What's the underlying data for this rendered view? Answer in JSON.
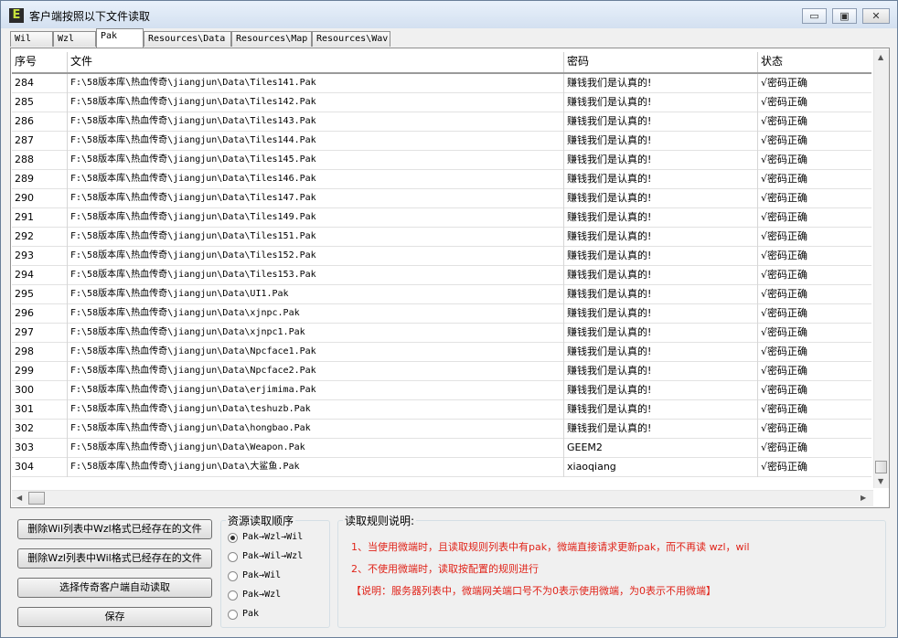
{
  "window": {
    "title": "客户端按照以下文件读取",
    "icon_letter": "E",
    "minimize": "▭",
    "maximize": "▣",
    "close": "✕"
  },
  "tabs": [
    "Wil",
    "Wzl",
    "Pak",
    "Resources\\Data",
    "Resources\\Map",
    "Resources\\Wav"
  ],
  "active_tab": "Pak",
  "table": {
    "headers": [
      "序号",
      "文件",
      "密码",
      "状态"
    ],
    "rows": [
      [
        "284",
        "F:\\58版本库\\热血传奇\\jiangjun\\Data\\Tiles141.Pak",
        "赚钱我们是认真的!",
        "√密码正确"
      ],
      [
        "285",
        "F:\\58版本库\\热血传奇\\jiangjun\\Data\\Tiles142.Pak",
        "赚钱我们是认真的!",
        "√密码正确"
      ],
      [
        "286",
        "F:\\58版本库\\热血传奇\\jiangjun\\Data\\Tiles143.Pak",
        "赚钱我们是认真的!",
        "√密码正确"
      ],
      [
        "287",
        "F:\\58版本库\\热血传奇\\jiangjun\\Data\\Tiles144.Pak",
        "赚钱我们是认真的!",
        "√密码正确"
      ],
      [
        "288",
        "F:\\58版本库\\热血传奇\\jiangjun\\Data\\Tiles145.Pak",
        "赚钱我们是认真的!",
        "√密码正确"
      ],
      [
        "289",
        "F:\\58版本库\\热血传奇\\jiangjun\\Data\\Tiles146.Pak",
        "赚钱我们是认真的!",
        "√密码正确"
      ],
      [
        "290",
        "F:\\58版本库\\热血传奇\\jiangjun\\Data\\Tiles147.Pak",
        "赚钱我们是认真的!",
        "√密码正确"
      ],
      [
        "291",
        "F:\\58版本库\\热血传奇\\jiangjun\\Data\\Tiles149.Pak",
        "赚钱我们是认真的!",
        "√密码正确"
      ],
      [
        "292",
        "F:\\58版本库\\热血传奇\\jiangjun\\Data\\Tiles151.Pak",
        "赚钱我们是认真的!",
        "√密码正确"
      ],
      [
        "293",
        "F:\\58版本库\\热血传奇\\jiangjun\\Data\\Tiles152.Pak",
        "赚钱我们是认真的!",
        "√密码正确"
      ],
      [
        "294",
        "F:\\58版本库\\热血传奇\\jiangjun\\Data\\Tiles153.Pak",
        "赚钱我们是认真的!",
        "√密码正确"
      ],
      [
        "295",
        "F:\\58版本库\\热血传奇\\jiangjun\\Data\\UI1.Pak",
        "赚钱我们是认真的!",
        "√密码正确"
      ],
      [
        "296",
        "F:\\58版本库\\热血传奇\\jiangjun\\Data\\xjnpc.Pak",
        "赚钱我们是认真的!",
        "√密码正确"
      ],
      [
        "297",
        "F:\\58版本库\\热血传奇\\jiangjun\\Data\\xjnpc1.Pak",
        "赚钱我们是认真的!",
        "√密码正确"
      ],
      [
        "298",
        "F:\\58版本库\\热血传奇\\jiangjun\\Data\\Npcface1.Pak",
        "赚钱我们是认真的!",
        "√密码正确"
      ],
      [
        "299",
        "F:\\58版本库\\热血传奇\\jiangjun\\Data\\Npcface2.Pak",
        "赚钱我们是认真的!",
        "√密码正确"
      ],
      [
        "300",
        "F:\\58版本库\\热血传奇\\jiangjun\\Data\\erjimima.Pak",
        "赚钱我们是认真的!",
        "√密码正确"
      ],
      [
        "301",
        "F:\\58版本库\\热血传奇\\jiangjun\\Data\\teshuzb.Pak",
        "赚钱我们是认真的!",
        "√密码正确"
      ],
      [
        "302",
        "F:\\58版本库\\热血传奇\\jiangjun\\Data\\hongbao.Pak",
        "赚钱我们是认真的!",
        "√密码正确"
      ],
      [
        "303",
        "F:\\58版本库\\热血传奇\\jiangjun\\Data\\Weapon.Pak",
        "GEEM2",
        "√密码正确"
      ],
      [
        "304",
        "F:\\58版本库\\热血传奇\\jiangjun\\Data\\大鲨鱼.Pak",
        "xiaoqiang",
        "√密码正确"
      ]
    ]
  },
  "buttons": {
    "delete_wil": "删除Wil列表中Wzl格式已经存在的文件",
    "delete_wzl": "删除Wzl列表中Wil格式已经存在的文件",
    "auto_read": "选择传奇客户端自动读取",
    "save": "保存"
  },
  "resource_order": {
    "title": "资源读取顺序",
    "options": [
      "Pak→Wzl→Wil",
      "Pak→Wil→Wzl",
      "Pak→Wil",
      "Pak→Wzl",
      "Pak"
    ],
    "selected": "Pak→Wzl→Wil"
  },
  "rules": {
    "title": "读取规则说明:",
    "lines": [
      "1、当使用微端时，且读取规则列表中有pak，微端直接请求更新pak，而不再读 wzl，wil",
      "2、不使用微端时，读取按配置的规则进行",
      "【说明：服务器列表中，微端网关端口号不为0表示使用微端，为0表示不用微端】"
    ],
    "color": "#e0241a"
  }
}
